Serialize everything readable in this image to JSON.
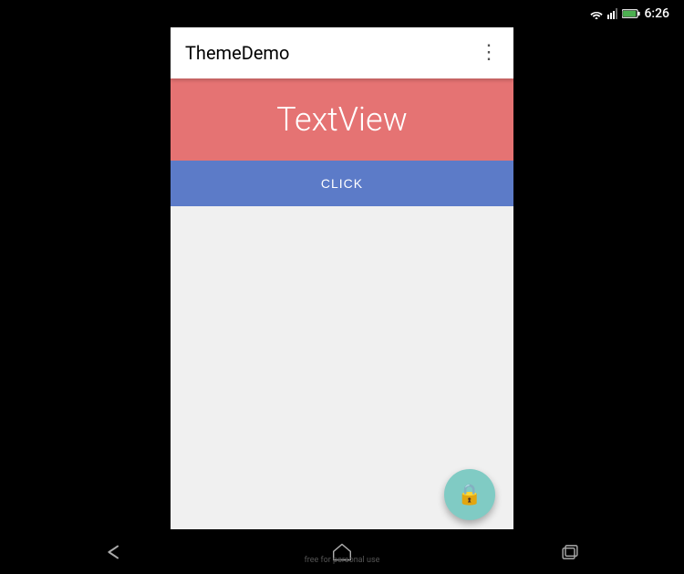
{
  "statusBar": {
    "time": "6:26",
    "wifiIcon": "wifi",
    "signalIcon": "signal",
    "batteryIcon": "battery"
  },
  "appBar": {
    "title": "ThemeDemo",
    "menuIcon": "⋮"
  },
  "textView": {
    "label": "TextView"
  },
  "clickButton": {
    "label": "CLICK"
  },
  "fab": {
    "icon": "🔒"
  },
  "navBar": {
    "backLabel": "free for personal use",
    "items": [
      {
        "icon": "back",
        "label": ""
      },
      {
        "icon": "home",
        "label": ""
      },
      {
        "icon": "recents",
        "label": ""
      }
    ]
  },
  "colors": {
    "statusBar": "#000000",
    "appBar": "#ffffff",
    "textViewBg": "#E57373",
    "clickButtonBg": "#5C7BC8",
    "mainBg": "#f0f0f0",
    "fabBg": "#80CBC4",
    "navBar": "#000000"
  }
}
